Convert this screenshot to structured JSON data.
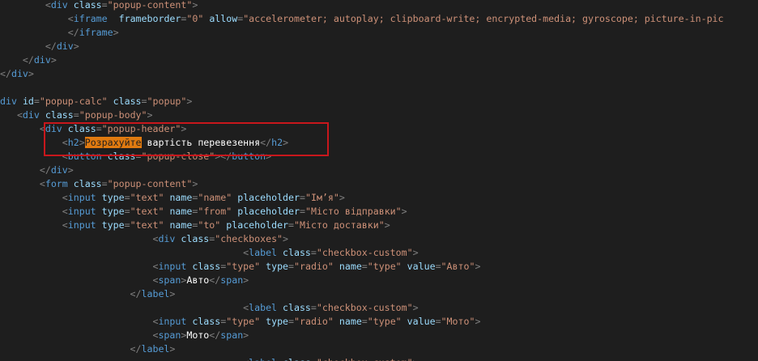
{
  "editor": {
    "annotation_color": "#c8171c",
    "search_highlight_color": "#e07a10",
    "lines": [
      [
        [
          "p",
          "        <"
        ],
        [
          "t",
          "div"
        ],
        [
          "p",
          " "
        ],
        [
          "a",
          "class"
        ],
        [
          "p",
          "="
        ],
        [
          "s",
          "\"popup-content\""
        ],
        [
          "p",
          ">"
        ]
      ],
      [
        [
          "p",
          "            <"
        ],
        [
          "t",
          "iframe"
        ],
        [
          "p",
          "  "
        ],
        [
          "a",
          "frameborder"
        ],
        [
          "p",
          "="
        ],
        [
          "s",
          "\"0\""
        ],
        [
          "p",
          " "
        ],
        [
          "a",
          "allow"
        ],
        [
          "p",
          "="
        ],
        [
          "s",
          "\"accelerometer; autoplay; clipboard-write; encrypted-media; gyroscope; picture-in-pic"
        ]
      ],
      [
        [
          "p",
          "            </"
        ],
        [
          "t",
          "iframe"
        ],
        [
          "p",
          ">"
        ]
      ],
      [
        [
          "p",
          "        </"
        ],
        [
          "t",
          "div"
        ],
        [
          "p",
          ">"
        ]
      ],
      [
        [
          "p",
          "    </"
        ],
        [
          "t",
          "div"
        ],
        [
          "p",
          ">"
        ]
      ],
      [
        [
          "p",
          "</"
        ],
        [
          "t",
          "div"
        ],
        [
          "p",
          ">"
        ]
      ],
      [
        [
          "p",
          ""
        ]
      ],
      [
        [
          "t",
          "div"
        ],
        [
          "p",
          " "
        ],
        [
          "a",
          "id"
        ],
        [
          "p",
          "="
        ],
        [
          "s",
          "\"popup-calc\""
        ],
        [
          "p",
          " "
        ],
        [
          "a",
          "class"
        ],
        [
          "p",
          "="
        ],
        [
          "s",
          "\"popup\""
        ],
        [
          "p",
          ">"
        ]
      ],
      [
        [
          "p",
          "   <"
        ],
        [
          "t",
          "div"
        ],
        [
          "p",
          " "
        ],
        [
          "a",
          "class"
        ],
        [
          "p",
          "="
        ],
        [
          "s",
          "\"popup-body\""
        ],
        [
          "p",
          ">"
        ]
      ],
      [
        [
          "p",
          "       <"
        ],
        [
          "t",
          "div"
        ],
        [
          "p",
          " "
        ],
        [
          "a",
          "class"
        ],
        [
          "p",
          "="
        ],
        [
          "s",
          "\"popup-header\""
        ],
        [
          "p",
          ">"
        ]
      ],
      [
        [
          "p",
          "           <"
        ],
        [
          "t",
          "h2"
        ],
        [
          "p",
          ">"
        ],
        [
          "h",
          "Розрахуйте"
        ],
        [
          "w",
          " вартість перевезення"
        ],
        [
          "p",
          "</"
        ],
        [
          "t",
          "h2"
        ],
        [
          "p",
          ">"
        ]
      ],
      [
        [
          "p",
          "           <"
        ],
        [
          "t",
          "button"
        ],
        [
          "p",
          " "
        ],
        [
          "a",
          "class"
        ],
        [
          "p",
          "="
        ],
        [
          "s",
          "\"popup-close\""
        ],
        [
          "p",
          "></"
        ],
        [
          "t",
          "button"
        ],
        [
          "p",
          ">"
        ]
      ],
      [
        [
          "p",
          "       </"
        ],
        [
          "t",
          "div"
        ],
        [
          "p",
          ">"
        ]
      ],
      [
        [
          "p",
          "       <"
        ],
        [
          "t",
          "form"
        ],
        [
          "p",
          " "
        ],
        [
          "a",
          "class"
        ],
        [
          "p",
          "="
        ],
        [
          "s",
          "\"popup-content\""
        ],
        [
          "p",
          ">"
        ]
      ],
      [
        [
          "p",
          "           <"
        ],
        [
          "t",
          "input"
        ],
        [
          "p",
          " "
        ],
        [
          "a",
          "type"
        ],
        [
          "p",
          "="
        ],
        [
          "s",
          "\"text\""
        ],
        [
          "p",
          " "
        ],
        [
          "a",
          "name"
        ],
        [
          "p",
          "="
        ],
        [
          "s",
          "\"name\""
        ],
        [
          "p",
          " "
        ],
        [
          "a",
          "placeholder"
        ],
        [
          "p",
          "="
        ],
        [
          "s",
          "\"Ім’я\""
        ],
        [
          "p",
          ">"
        ]
      ],
      [
        [
          "p",
          "           <"
        ],
        [
          "t",
          "input"
        ],
        [
          "p",
          " "
        ],
        [
          "a",
          "type"
        ],
        [
          "p",
          "="
        ],
        [
          "s",
          "\"text\""
        ],
        [
          "p",
          " "
        ],
        [
          "a",
          "name"
        ],
        [
          "p",
          "="
        ],
        [
          "s",
          "\"from\""
        ],
        [
          "p",
          " "
        ],
        [
          "a",
          "placeholder"
        ],
        [
          "p",
          "="
        ],
        [
          "s",
          "\"Місто відправки\""
        ],
        [
          "p",
          ">"
        ]
      ],
      [
        [
          "p",
          "           <"
        ],
        [
          "t",
          "input"
        ],
        [
          "p",
          " "
        ],
        [
          "a",
          "type"
        ],
        [
          "p",
          "="
        ],
        [
          "s",
          "\"text\""
        ],
        [
          "p",
          " "
        ],
        [
          "a",
          "name"
        ],
        [
          "p",
          "="
        ],
        [
          "s",
          "\"to\""
        ],
        [
          "p",
          " "
        ],
        [
          "a",
          "placeholder"
        ],
        [
          "p",
          "="
        ],
        [
          "s",
          "\"Місто доставки\""
        ],
        [
          "p",
          ">"
        ]
      ],
      [
        [
          "p",
          "                           <"
        ],
        [
          "t",
          "div"
        ],
        [
          "p",
          " "
        ],
        [
          "a",
          "class"
        ],
        [
          "p",
          "="
        ],
        [
          "s",
          "\"checkboxes\""
        ],
        [
          "p",
          ">"
        ]
      ],
      [
        [
          "p",
          "                                           <"
        ],
        [
          "t",
          "label"
        ],
        [
          "p",
          " "
        ],
        [
          "a",
          "class"
        ],
        [
          "p",
          "="
        ],
        [
          "s",
          "\"checkbox-custom\""
        ],
        [
          "p",
          ">"
        ]
      ],
      [
        [
          "p",
          "                           <"
        ],
        [
          "t",
          "input"
        ],
        [
          "p",
          " "
        ],
        [
          "a",
          "class"
        ],
        [
          "p",
          "="
        ],
        [
          "s",
          "\"type\""
        ],
        [
          "p",
          " "
        ],
        [
          "a",
          "type"
        ],
        [
          "p",
          "="
        ],
        [
          "s",
          "\"radio\""
        ],
        [
          "p",
          " "
        ],
        [
          "a",
          "name"
        ],
        [
          "p",
          "="
        ],
        [
          "s",
          "\"type\""
        ],
        [
          "p",
          " "
        ],
        [
          "a",
          "value"
        ],
        [
          "p",
          "="
        ],
        [
          "s",
          "\"Авто\""
        ],
        [
          "p",
          ">"
        ]
      ],
      [
        [
          "p",
          "                           <"
        ],
        [
          "t",
          "span"
        ],
        [
          "p",
          ">"
        ],
        [
          "w",
          "Авто"
        ],
        [
          "p",
          "</"
        ],
        [
          "t",
          "span"
        ],
        [
          "p",
          ">"
        ]
      ],
      [
        [
          "p",
          "                       </"
        ],
        [
          "t",
          "label"
        ],
        [
          "p",
          ">"
        ]
      ],
      [
        [
          "p",
          "                                           <"
        ],
        [
          "t",
          "label"
        ],
        [
          "p",
          " "
        ],
        [
          "a",
          "class"
        ],
        [
          "p",
          "="
        ],
        [
          "s",
          "\"checkbox-custom\""
        ],
        [
          "p",
          ">"
        ]
      ],
      [
        [
          "p",
          "                           <"
        ],
        [
          "t",
          "input"
        ],
        [
          "p",
          " "
        ],
        [
          "a",
          "class"
        ],
        [
          "p",
          "="
        ],
        [
          "s",
          "\"type\""
        ],
        [
          "p",
          " "
        ],
        [
          "a",
          "type"
        ],
        [
          "p",
          "="
        ],
        [
          "s",
          "\"radio\""
        ],
        [
          "p",
          " "
        ],
        [
          "a",
          "name"
        ],
        [
          "p",
          "="
        ],
        [
          "s",
          "\"type\""
        ],
        [
          "p",
          " "
        ],
        [
          "a",
          "value"
        ],
        [
          "p",
          "="
        ],
        [
          "s",
          "\"Мото\""
        ],
        [
          "p",
          ">"
        ]
      ],
      [
        [
          "p",
          "                           <"
        ],
        [
          "t",
          "span"
        ],
        [
          "p",
          ">"
        ],
        [
          "w",
          "Мото"
        ],
        [
          "p",
          "</"
        ],
        [
          "t",
          "span"
        ],
        [
          "p",
          ">"
        ]
      ],
      [
        [
          "p",
          "                       </"
        ],
        [
          "t",
          "label"
        ],
        [
          "p",
          ">"
        ]
      ],
      [
        [
          "p",
          "                                           <"
        ],
        [
          "t",
          "label"
        ],
        [
          "p",
          " "
        ],
        [
          "a",
          "class"
        ],
        [
          "p",
          "="
        ],
        [
          "s",
          "\"checkbox-custom\""
        ],
        [
          "p",
          ">"
        ]
      ]
    ]
  }
}
